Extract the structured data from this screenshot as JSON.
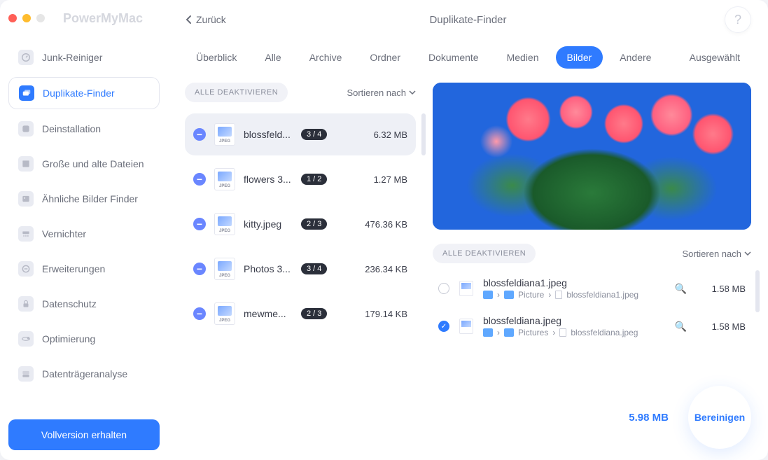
{
  "brand": "PowerMyMac",
  "back_label": "Zurück",
  "title": "Duplikate-Finder",
  "help_label": "?",
  "sidebar": {
    "items": [
      {
        "label": "Junk-Reiniger"
      },
      {
        "label": "Duplikate-Finder"
      },
      {
        "label": "Deinstallation"
      },
      {
        "label": "Große und alte Dateien"
      },
      {
        "label": "Ähnliche Bilder Finder"
      },
      {
        "label": "Vernichter"
      },
      {
        "label": "Erweiterungen"
      },
      {
        "label": "Datenschutz"
      },
      {
        "label": "Optimierung"
      },
      {
        "label": "Datenträgeranalyse"
      }
    ],
    "upgrade": "Vollversion erhalten"
  },
  "tabs": [
    {
      "label": "Überblick"
    },
    {
      "label": "Alle"
    },
    {
      "label": "Archive"
    },
    {
      "label": "Ordner"
    },
    {
      "label": "Dokumente"
    },
    {
      "label": "Medien"
    },
    {
      "label": "Bilder",
      "active": true
    },
    {
      "label": "Andere"
    },
    {
      "label": "Ausgewählt"
    }
  ],
  "left": {
    "deselect": "ALLE DEAKTIVIEREN",
    "sort": "Sortieren nach",
    "thumb_tag": "JPEG",
    "groups": [
      {
        "name": "blossfeld...",
        "count": "3 / 4",
        "size": "6.32 MB",
        "selected": true
      },
      {
        "name": "flowers 3...",
        "count": "1 / 2",
        "size": "1.27 MB"
      },
      {
        "name": "kitty.jpeg",
        "count": "2 / 3",
        "size": "476.36 KB"
      },
      {
        "name": "Photos 3...",
        "count": "3 / 4",
        "size": "236.34 KB"
      },
      {
        "name": "mewme...",
        "count": "2 / 3",
        "size": "179.14 KB"
      }
    ]
  },
  "right": {
    "deselect": "ALLE DEAKTIVIEREN",
    "sort": "Sortieren nach",
    "items": [
      {
        "name": "blossfeldiana1.jpeg",
        "path1": "Picture",
        "path2": "blossfeldiana1.jpeg",
        "size": "1.58 MB",
        "checked": false
      },
      {
        "name": "blossfeldiana.jpeg",
        "path1": "Pictures",
        "path2": "blossfeldiana.jpeg",
        "size": "1.58 MB",
        "checked": true
      }
    ]
  },
  "footer": {
    "total": "5.98 MB",
    "clean": "Bereinigen"
  }
}
